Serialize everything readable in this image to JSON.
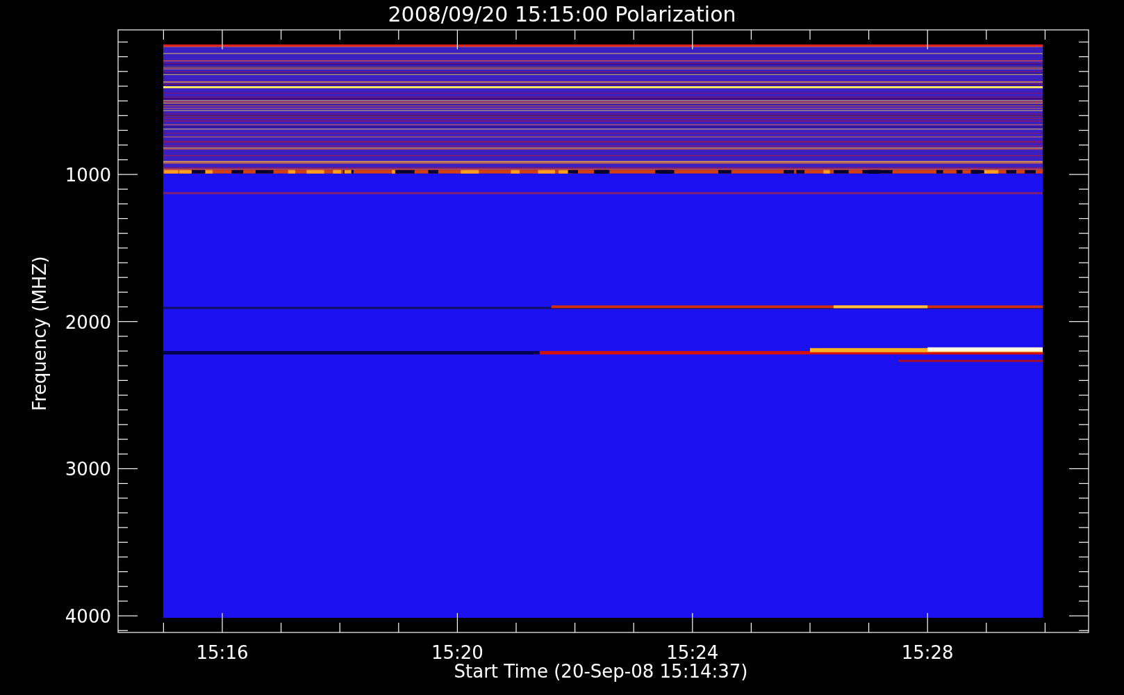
{
  "plot": {
    "title": "2008/09/20 15:15:00 Polarization",
    "xlabel": "Start Time (20-Sep-08 15:14:37)",
    "ylabel": "Frequency (MHZ)",
    "xticks": [
      "15:16",
      "15:20",
      "15:24",
      "15:28"
    ],
    "yticks": [
      "1000",
      "2000",
      "3000",
      "4000"
    ]
  }
}
